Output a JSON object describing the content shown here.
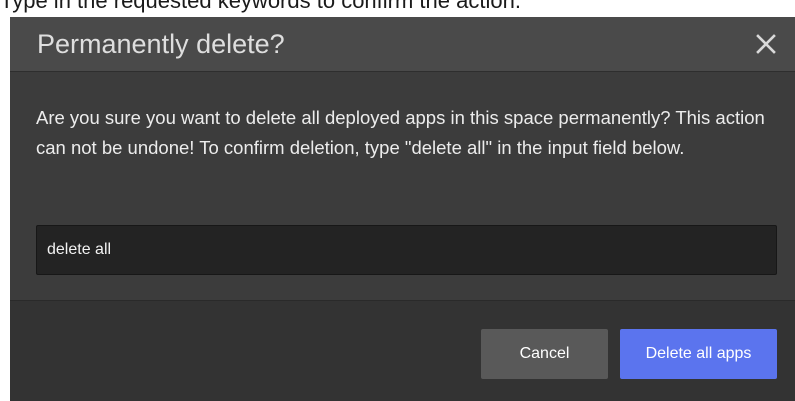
{
  "caption": "Type in the requested keywords to confirm the action.",
  "dialog": {
    "title": "Permanently delete?",
    "close_icon": "close-icon",
    "message": "Are you sure you want to delete all deployed apps in this space permanently? This action can not be undone! To confirm deletion, type \"delete all\" in the input field below.",
    "input_value": "delete all",
    "cancel_label": "Cancel",
    "delete_label": "Delete all apps"
  },
  "colors": {
    "header_bg": "#4a4a4a",
    "body_bg": "#3c3c3c",
    "footer_bg": "#333333",
    "input_bg": "#232323",
    "cancel_bg": "#595959",
    "delete_bg": "#5b74ee"
  }
}
